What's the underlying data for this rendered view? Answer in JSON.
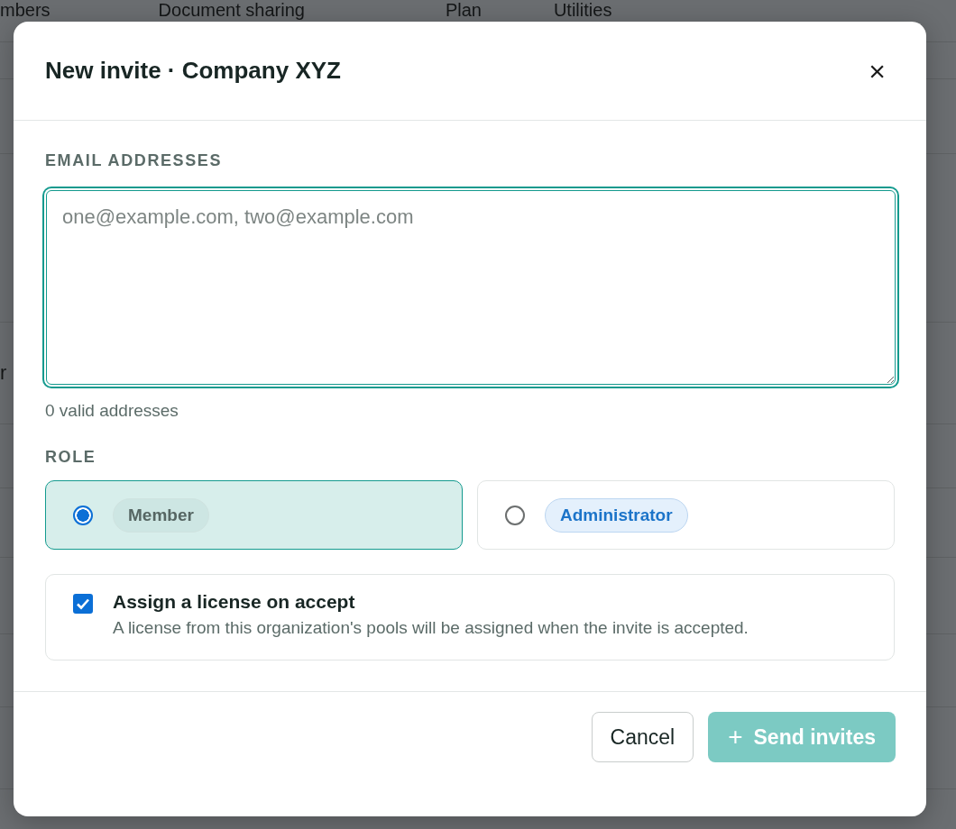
{
  "background": {
    "tabs": [
      {
        "label": "mbers"
      },
      {
        "label": "Document sharing"
      },
      {
        "label": "Plan"
      },
      {
        "label": "Utilities"
      }
    ],
    "row_fragments": [
      "r"
    ]
  },
  "dialog": {
    "title": "New invite · Company XYZ",
    "close": "×",
    "email": {
      "label": "EMAIL ADDRESSES",
      "placeholder": "one@example.com, two@example.com",
      "hint": "0 valid addresses"
    },
    "role": {
      "label": "ROLE",
      "options": [
        {
          "label": "Member",
          "kind": "member",
          "selected": true
        },
        {
          "label": "Administrator",
          "kind": "admin",
          "selected": false
        }
      ]
    },
    "license": {
      "title": "Assign a license on accept",
      "description": "A license from this organization's pools will be assigned when the invite is accepted.",
      "checked": true
    },
    "buttons": [
      {
        "label": "Cancel",
        "kind": "secondary",
        "disabled": false
      },
      {
        "label": "Send invites",
        "icon": "+",
        "kind": "primary",
        "disabled": true
      }
    ]
  }
}
